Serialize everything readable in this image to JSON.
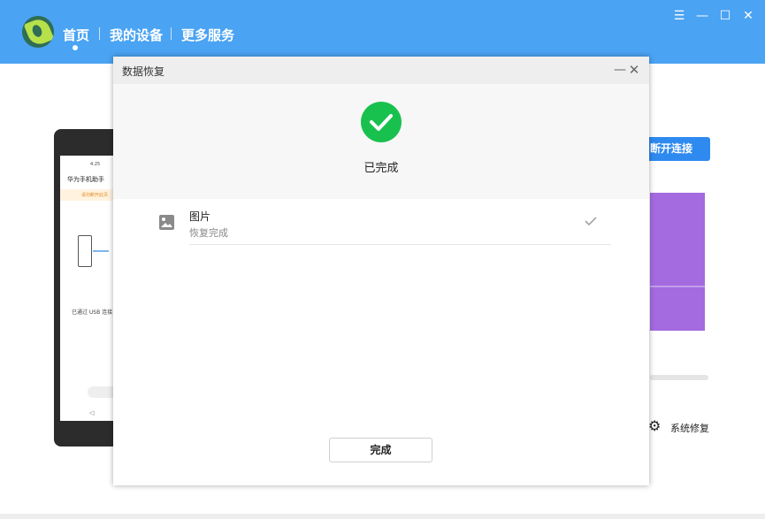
{
  "app": {
    "nav": [
      "首页",
      "我的设备",
      "更多服务"
    ],
    "window_controls": {
      "menu": "☰",
      "minimize": "—",
      "maximize": "☐",
      "close": "✕"
    }
  },
  "background": {
    "phone": {
      "status_time": "4:25",
      "app_name": "华为手机助手",
      "tip": "请勿断开此页",
      "connected": "已通过 USB 连接"
    },
    "disconnect_button": "断开连接",
    "system_repair": "系统修复"
  },
  "dialog": {
    "title": "数据恢复",
    "status": "已完成",
    "items": [
      {
        "name": "图片",
        "status": "恢复完成"
      }
    ],
    "done_button": "完成"
  },
  "colors": {
    "header": "#4aa3f3",
    "accent": "#2f8af0",
    "success": "#18c14e"
  }
}
